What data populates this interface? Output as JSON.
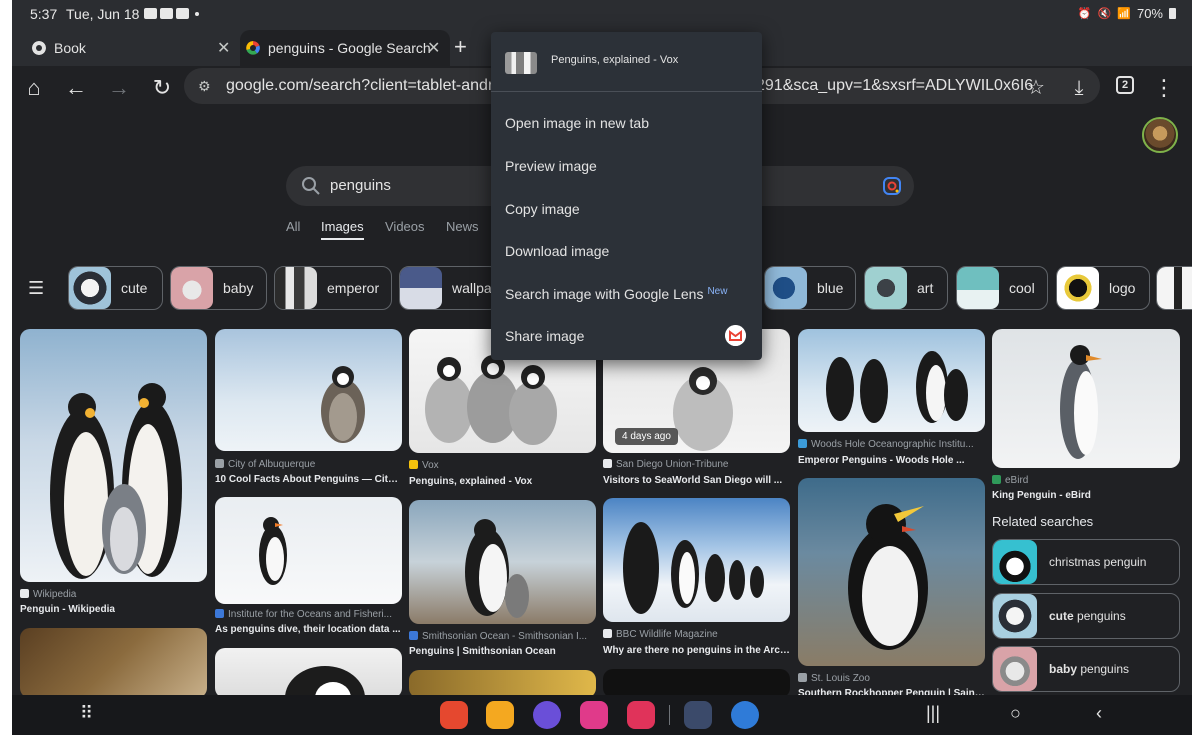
{
  "status_bar": {
    "time": "5:37",
    "date": "Tue, Jun 18",
    "battery": "70%"
  },
  "tabs": [
    {
      "label": "Book"
    },
    {
      "label": "penguins - Google Search"
    }
  ],
  "toolbar": {
    "url_left": "google.com/search?client=tablet-android-",
    "url_right": "291&sca_upv=1&sxsrf=ADLYWIL0x6I6",
    "tab_count": "2"
  },
  "search": {
    "query": "penguins"
  },
  "filter_tabs": [
    "All",
    "Images",
    "Videos",
    "News"
  ],
  "chips": [
    {
      "label": "cute",
      "color": "#9fc3d9"
    },
    {
      "label": "baby",
      "color": "#d9a3a8"
    },
    {
      "label": "emperor",
      "color": "#b8bcc0"
    },
    {
      "label": "wallpa",
      "color": "#4a5a8a"
    },
    {
      "label": "blue",
      "color": "#3f7fb8"
    },
    {
      "label": "art",
      "color": "#9fd0d0"
    },
    {
      "label": "cool",
      "color": "#6fbfbf"
    },
    {
      "label": "logo",
      "color": "#e8c93a"
    }
  ],
  "results": [
    {
      "source": "Wikipedia",
      "title": "Penguin - Wikipedia"
    },
    {
      "source": "City of Albuquerque",
      "title": "10 Cool Facts About Penguins — City ..."
    },
    {
      "source": "Vox",
      "title": "Penguins, explained - Vox"
    },
    {
      "source": "San Diego Union-Tribune",
      "title": "Visitors to SeaWorld San Diego will ...",
      "badge": "4 days ago"
    },
    {
      "source": "Woods Hole Oceanographic Institu...",
      "title": "Emperor Penguins - Woods Hole ..."
    },
    {
      "source": "eBird",
      "title": "King Penguin - eBird"
    },
    {
      "source": "Institute for the Oceans and Fisheri...",
      "title": "As penguins dive, their location data ..."
    },
    {
      "source": "Smithsonian Ocean - Smithsonian I...",
      "title": "Penguins | Smithsonian Ocean"
    },
    {
      "source": "BBC Wildlife Magazine",
      "title": "Why are there no penguins in the Arcti..."
    },
    {
      "source": "St. Louis Zoo",
      "title": "Southern Rockhopper Penguin | Saint ..."
    }
  ],
  "related": {
    "heading": "Related searches",
    "items": [
      {
        "bold": "",
        "rest": "christmas penguin"
      },
      {
        "bold": "cute",
        "rest": " penguins"
      },
      {
        "bold": "baby",
        "rest": " penguins"
      }
    ]
  },
  "context_menu": {
    "title": "Penguins, explained - Vox",
    "items": [
      "Open image in new tab",
      "Preview image",
      "Copy image",
      "Download image",
      "Search image with Google Lens",
      "Share image"
    ],
    "new_badge": "New"
  },
  "colors": {
    "background": "#202124",
    "menu": "#2c3138",
    "accent": "#8ab4f8"
  }
}
